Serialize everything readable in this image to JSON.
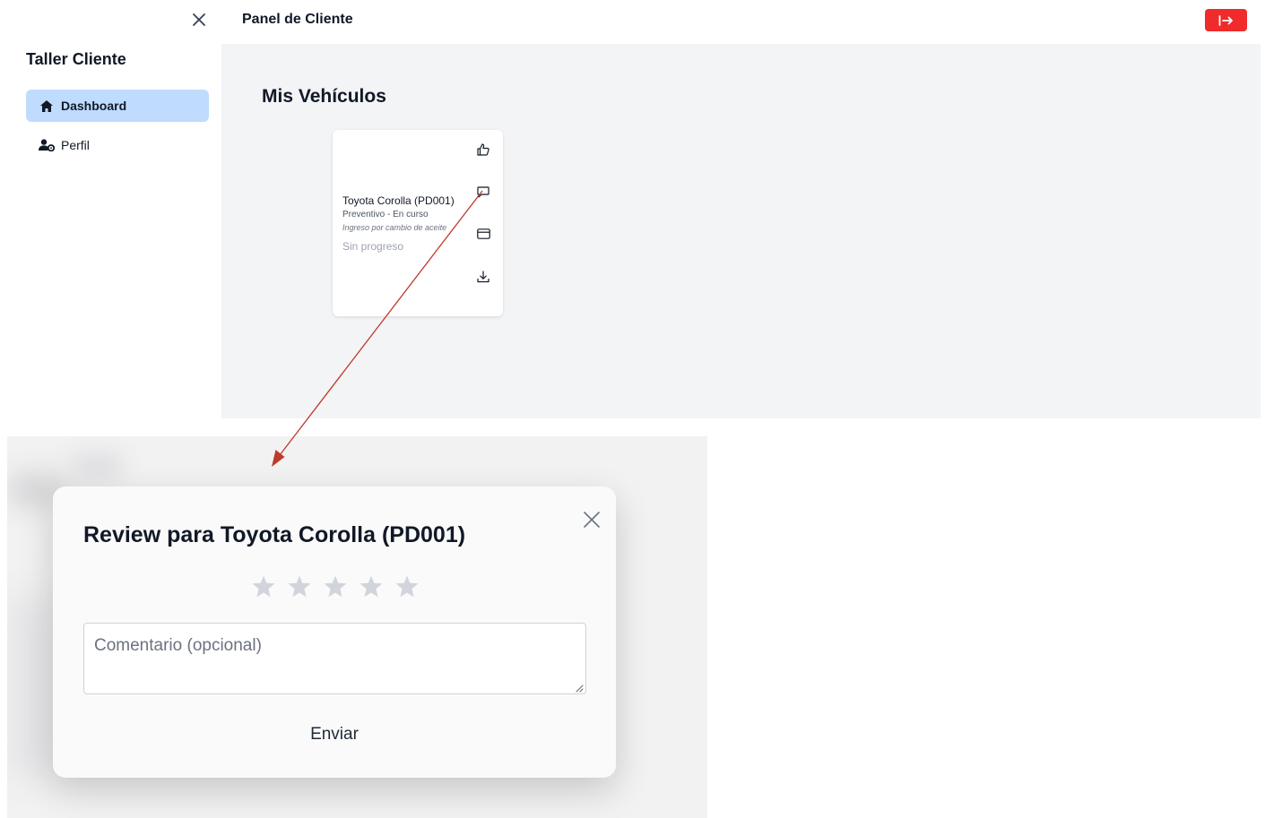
{
  "sidebar": {
    "title": "Taller Cliente",
    "items": [
      {
        "label": "Dashboard",
        "icon": "home-icon",
        "active": true
      },
      {
        "label": "Perfil",
        "icon": "user-gear-icon",
        "active": false
      }
    ]
  },
  "header": {
    "title": "Panel de Cliente",
    "logout_icon": "logout-icon",
    "logout_color": "#ef2b2b"
  },
  "main": {
    "section_title": "Mis Vehículos",
    "vehicle": {
      "name": "Toyota Corolla (PD001)",
      "type_status": "Preventivo - En curso",
      "description": "Ingreso por cambio de aceite",
      "progress": "Sin progreso",
      "actions": [
        "thumbs-up-icon",
        "comment-icon",
        "credit-card-icon",
        "download-icon"
      ]
    }
  },
  "modal": {
    "title": "Review para Toyota Corolla (PD001)",
    "stars_total": 5,
    "stars_selected": 0,
    "comment_placeholder": "Comentario (opcional)",
    "comment_value": "",
    "submit_label": "Enviar"
  },
  "colors": {
    "active_nav": "#bfdbfe",
    "main_bg": "#f3f4f6",
    "arrow": "#c0392b"
  }
}
